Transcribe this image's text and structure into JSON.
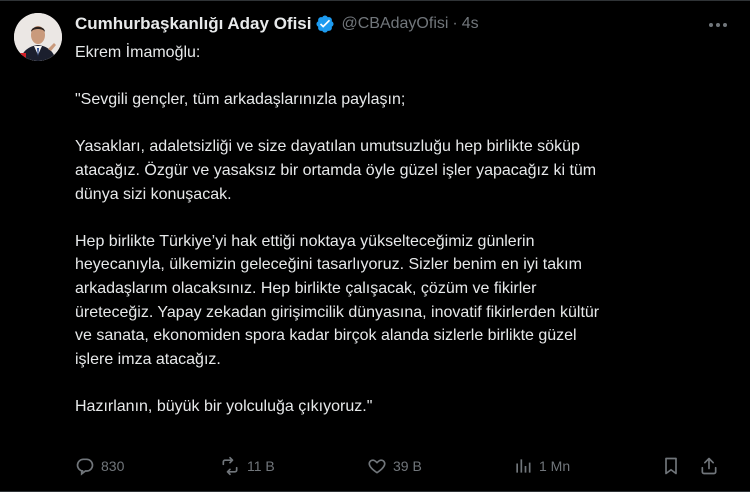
{
  "tweet": {
    "author_name": "Cumhurbaşkanlığı Aday Ofisi",
    "handle": "@CBAdayOfisi",
    "separator": "·",
    "time": "4s",
    "paragraphs": [
      [
        "Ekrem İmamoğlu:"
      ],
      [
        "\"Sevgili gençler, tüm arkadaşlarınızla paylaşın;"
      ],
      [
        "Yasakları, adaletsizliği ve size dayatılan umutsuzluğu hep birlikte söküp",
        "atacağız. Özgür ve yasaksız bir ortamda öyle güzel işler yapacağız ki tüm",
        "dünya sizi konuşacak."
      ],
      [
        "Hep birlikte Türkiye’yi hak ettiği noktaya yükselteceğimiz günlerin",
        "heyecanıyla, ülkemizin geleceğini tasarlıyoruz. Sizler benim en iyi takım",
        "arkadaşlarım olacaksınız. Hep birlikte çalışacak, çözüm ve fikirler",
        "üreteceğiz. Yapay zekadan girişimcilik dünyasına, inovatif fikirlerden kültür",
        "ve sanata, ekonomiden spora kadar birçok alanda sizlerle birlikte güzel",
        "işlere imza atacağız."
      ],
      [
        "Hazırlanın, büyük bir yolculuğa çıkıyoruz.\""
      ]
    ],
    "actions": {
      "replies": "830",
      "reposts": "11 B",
      "likes": "39 B",
      "views": "1 Mn"
    }
  },
  "icons": {
    "verified": "verified-badge-icon",
    "more": "more-options-icon",
    "reply": "reply-icon",
    "repost": "repost-icon",
    "like": "like-icon",
    "views": "views-icon",
    "bookmark": "bookmark-icon",
    "share": "share-icon"
  },
  "colors": {
    "background": "#000000",
    "text": "#e7e9ea",
    "muted": "#71767b",
    "verified": "#1d9bf0"
  }
}
